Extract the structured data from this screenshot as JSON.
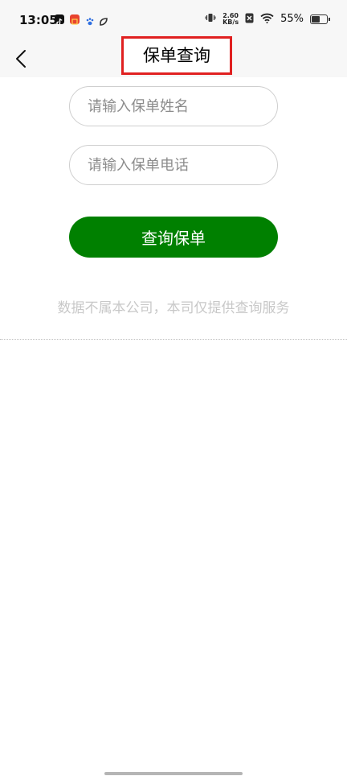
{
  "status_bar": {
    "time": "13:05",
    "net_speed_value": "2.60",
    "net_speed_unit": "KB/s",
    "battery_text": "55%",
    "battery_level": 0.55,
    "app_icons": [
      "tiktok-icon",
      "news-app-icon",
      "baidu-paw-icon",
      "link-app-icon"
    ],
    "icons": [
      "vibrate-icon",
      "sim-x-icon",
      "wifi-icon",
      "battery-icon"
    ]
  },
  "nav": {
    "title": "保单查询",
    "back_icon": "chevron-left-icon"
  },
  "form": {
    "name_placeholder": "请输入保单姓名",
    "phone_placeholder": "请输入保单电话",
    "submit_label": "查询保单"
  },
  "disclaimer": "数据不属本公司，本司仅提供查询服务",
  "colors": {
    "accent_green": "#008000",
    "highlight_red": "#e02020",
    "disclaimer_gray": "#c8c8c8"
  }
}
